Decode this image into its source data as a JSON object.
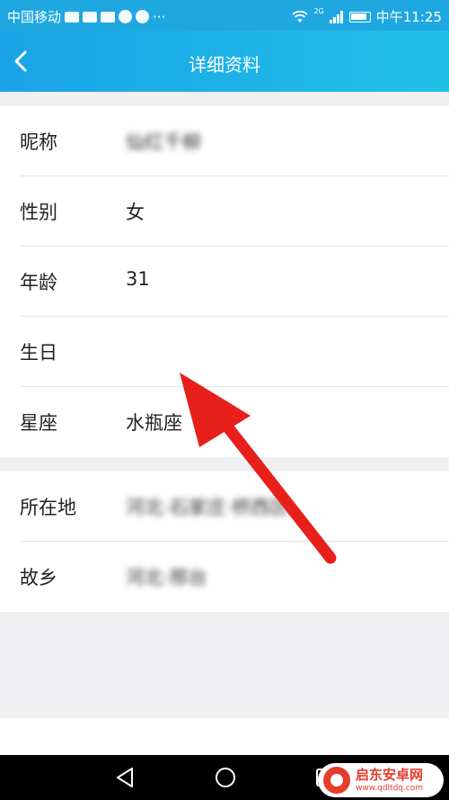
{
  "status_bar": {
    "carrier": "中国移动",
    "more": "···",
    "network_label": "2G",
    "time": "中午11:25"
  },
  "header": {
    "title": "详细资料"
  },
  "profile_basic": [
    {
      "label": "昵称",
      "value": "仙红千柳"
    },
    {
      "label": "性别",
      "value": "女"
    },
    {
      "label": "年龄",
      "value": "31"
    },
    {
      "label": "生日",
      "value": ""
    },
    {
      "label": "星座",
      "value": "水瓶座"
    }
  ],
  "profile_location": [
    {
      "label": "所在地",
      "value": "河北·石家庄·桥西区"
    },
    {
      "label": "故乡",
      "value": "河北·邢台"
    }
  ],
  "watermark": {
    "name": "启东安卓网",
    "url": "www.qdltdq.com"
  },
  "colors": {
    "header_start": "#1aa3e8",
    "header_end": "#20c0e6",
    "annotation_arrow": "#e8201c",
    "page_background": "#f0f0f2"
  }
}
